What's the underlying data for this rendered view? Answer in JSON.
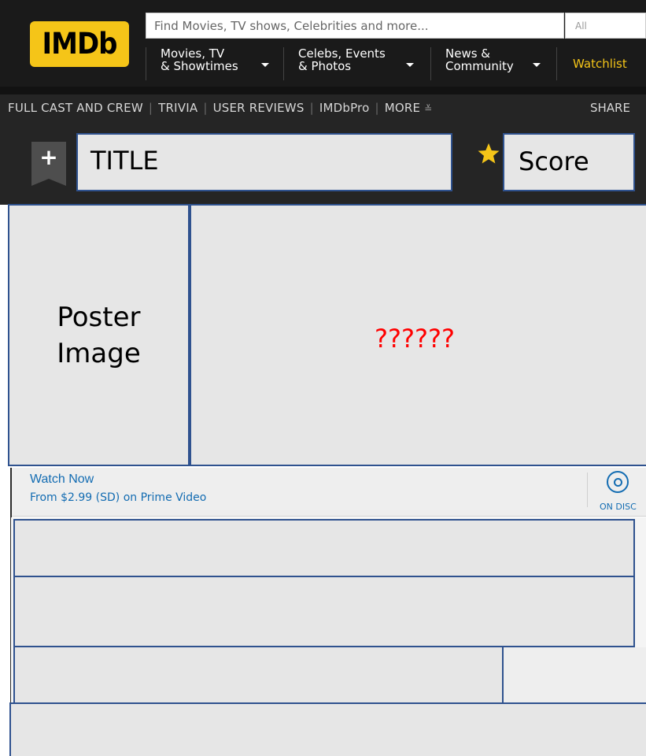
{
  "header": {
    "logo_text": "IMDb",
    "search_placeholder": "Find Movies, TV shows, Celebrities and more...",
    "search_category": "All",
    "nav": [
      {
        "line1": "Movies, TV",
        "line2": "& Showtimes"
      },
      {
        "line1": "Celebs, Events",
        "line2": "& Photos"
      },
      {
        "line1": "News &",
        "line2": "Community"
      }
    ],
    "watchlist_label": "Watchlist"
  },
  "subnav": {
    "links": [
      "FULL CAST AND CREW",
      "TRIVIA",
      "USER REVIEWS",
      "IMDbPro",
      "MORE"
    ],
    "more_icon": "chevron-double-down-icon",
    "share_label": "SHARE",
    "add_icon": "+"
  },
  "title_box": {
    "label": "TITLE"
  },
  "score_box": {
    "label": "Score"
  },
  "poster": {
    "line1": "Poster",
    "line2": "Image"
  },
  "unknown_region": {
    "label": "??????"
  },
  "watch_now": {
    "title": "Watch Now",
    "subtitle": "From $2.99 (SD) on Prime Video",
    "disc_label": "ON DISC"
  },
  "colors": {
    "imdb_yellow": "#f5c518",
    "header_bg": "#1a1a1a",
    "subnav_bg": "#252525",
    "placeholder_fill": "#e6e6e6",
    "placeholder_border": "#2f528f",
    "link_blue": "#136cb2",
    "question_red": "#ff0000"
  }
}
